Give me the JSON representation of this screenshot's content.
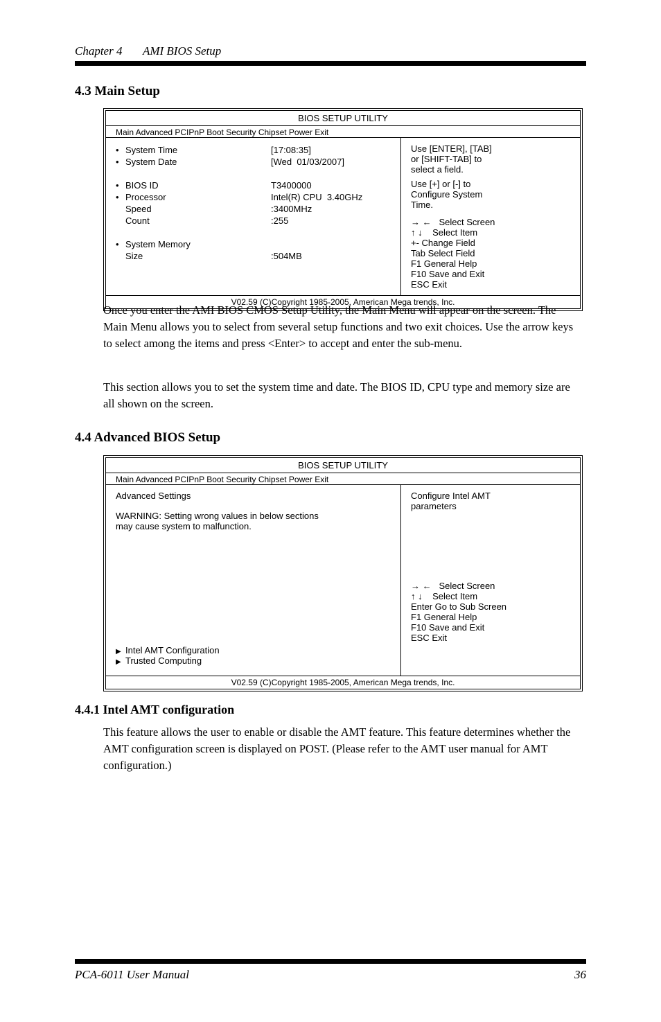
{
  "header": {
    "chapter": "Chapter 4",
    "title": "AMI BIOS Setup"
  },
  "section1": {
    "title": "4.3   Main Setup"
  },
  "bios1": {
    "head": "BIOS SETUP UTILITY",
    "tabs": "Main    Advanced    PCIPnP    Boot    Security    Chipset    Power    Exit",
    "rows": [
      {
        "lbl": "System Time",
        "val": "[17:08:35]",
        "bullet": true
      },
      {
        "lbl": "System Date",
        "val": "[Wed  01/03/2007]",
        "bullet": true
      },
      {
        "lbl": "",
        "val": ""
      },
      {
        "lbl": "BIOS ID",
        "val": "T3400000",
        "bullet": true
      },
      {
        "lbl": "Processor",
        "val": "Intel(R) CPU  3.40GHz",
        "bullet": true
      },
      {
        "lbl": "Speed",
        "val": ":3400MHz",
        "bullet": false
      },
      {
        "lbl": "Count",
        "val": ":255",
        "bullet": false
      },
      {
        "lbl": "",
        "val": ""
      },
      {
        "lbl": "System Memory",
        "val": "",
        "bullet": true
      },
      {
        "lbl": "Size",
        "val": ":504MB",
        "bullet": false
      }
    ],
    "help": {
      "l1": "Use [ENTER], [TAB]",
      "l2": "or [SHIFT-TAB] to",
      "l3": "select a field.",
      "l4": "Use [+] or [-] to",
      "l5": "Configure System",
      "l6": "Time.",
      "nav1a": "Select Screen",
      "nav2a": "Select Item",
      "nav3": "+-        Change Field",
      "nav4": "Tab      Select Field",
      "nav5": "F1        General Help",
      "nav6": "F10      Save and Exit",
      "nav7": "ESC     Exit"
    },
    "foot": "V02.59   (C)Copyright 1985-2005, American Mega trends, Inc."
  },
  "maindesc": {
    "d1": "Once you enter the AMI BIOS CMOS Setup Utility, the Main Menu will appear on the screen. The Main Menu allows you to select from several setup functions and two exit choices. Use the arrow keys to select among the items and press <Enter> to accept and enter the sub-menu.",
    "d2": "This section allows you to set the system time and date.  The BIOS ID, CPU type and memory size are all shown on the screen."
  },
  "section2": {
    "title": "4.4   Advanced BIOS Setup"
  },
  "bios2": {
    "head": "BIOS SETUP UTILITY",
    "tabs": "Main    Advanced    PCIPnP    Boot    Security    Chipset    Power    Exit",
    "adv": {
      "l1": "Advanced Settings",
      "l2": "WARNING: Setting wrong values in below sections",
      "l3": "                    may cause system to malfunction.",
      "sub1": "Intel AMT Configuration",
      "sub2": "Trusted Computing"
    },
    "help": {
      "l1": "Configure Intel AMT",
      "l2": "parameters",
      "nav1a": "Select Screen",
      "nav2a": "Select Item",
      "nav3": "Enter  Go to Sub Screen",
      "nav4": "F1       General Help",
      "nav5": "F10     Save and Exit",
      "nav6": "ESC    Exit"
    },
    "foot": "V02.59   (C)Copyright 1985-2005, American Mega trends, Inc."
  },
  "sub1": {
    "title": "4.4.1   Intel AMT configuration",
    "body": "This feature allows the user to enable or disable the AMT feature.  This feature determines whether the AMT configuration screen is displayed on POST.  (Please refer to the AMT user manual for AMT configuration.)"
  },
  "footer": {
    "left": "PCA-6011 User Manual",
    "right": "36"
  }
}
